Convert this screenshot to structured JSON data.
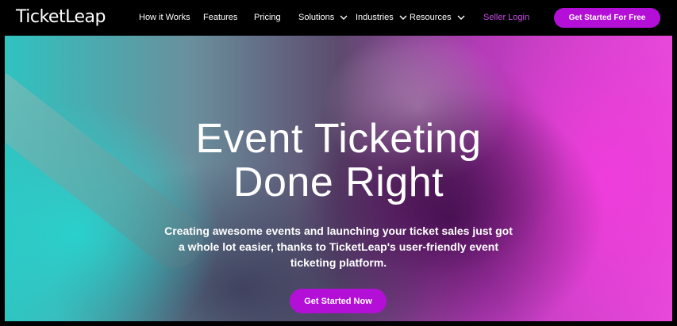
{
  "brand": {
    "logo_text": "TicketLeap"
  },
  "nav": {
    "items": [
      {
        "label": "How it Works",
        "has_dropdown": false
      },
      {
        "label": "Features",
        "has_dropdown": false
      },
      {
        "label": "Pricing",
        "has_dropdown": false
      },
      {
        "label": "Solutions",
        "has_dropdown": true
      },
      {
        "label": "Industries",
        "has_dropdown": true
      },
      {
        "label": "Resources",
        "has_dropdown": true
      }
    ],
    "seller_login": "Seller Login",
    "cta": "Get Started For Free"
  },
  "hero": {
    "title_line1": "Event Ticketing",
    "title_line2": "Done Right",
    "subtitle": "Creating awesome events and launching your ticket sales just got a whole lot easier, thanks to TicketLeap's user-friendly event ticketing platform.",
    "cta": "Get Started Now"
  },
  "colors": {
    "accent": "#b40fd6",
    "seller_login": "#c94de9",
    "background": "#000000"
  }
}
